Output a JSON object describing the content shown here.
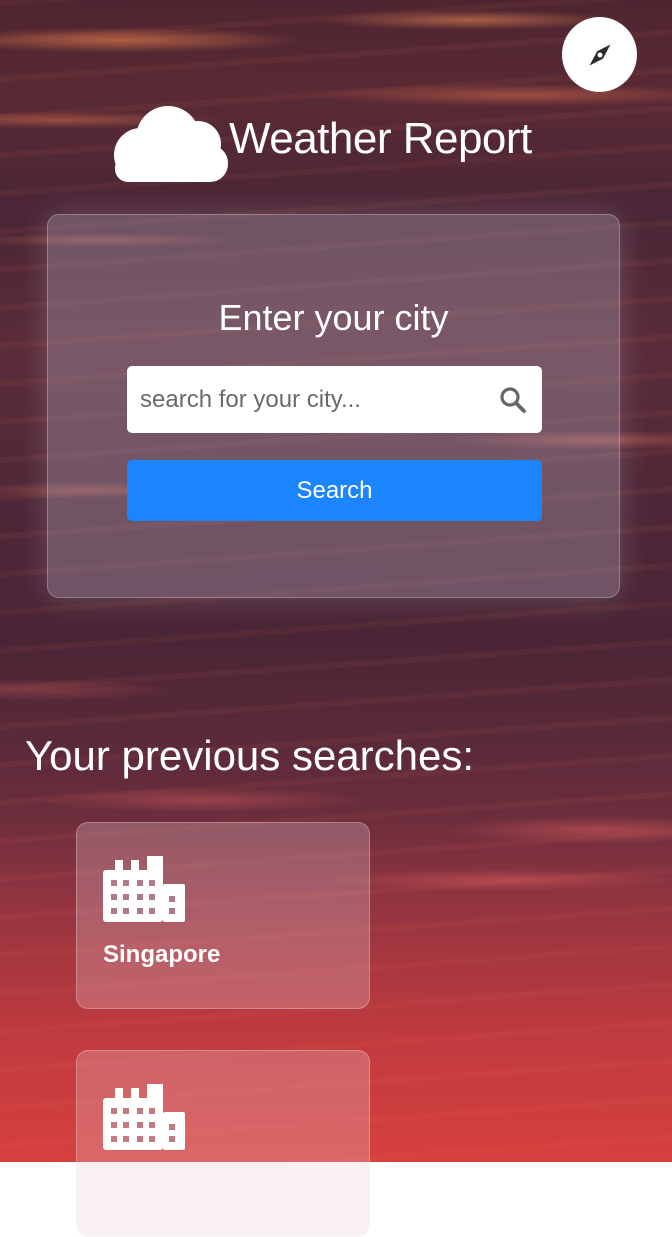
{
  "app": {
    "title": "Weather Report"
  },
  "search": {
    "heading": "Enter your city",
    "placeholder": "search for your city...",
    "button_label": "Search"
  },
  "previous": {
    "heading": "Your previous searches:",
    "items": [
      {
        "name": "Singapore",
        "icon": "city-icon"
      },
      {
        "name": "",
        "icon": "city-icon"
      }
    ]
  },
  "icons": {
    "top_right": "compass-icon",
    "logo": "cloud-icon",
    "search_field": "search-icon"
  },
  "colors": {
    "primary_button": "#1a85ff",
    "text": "#ffffff"
  }
}
